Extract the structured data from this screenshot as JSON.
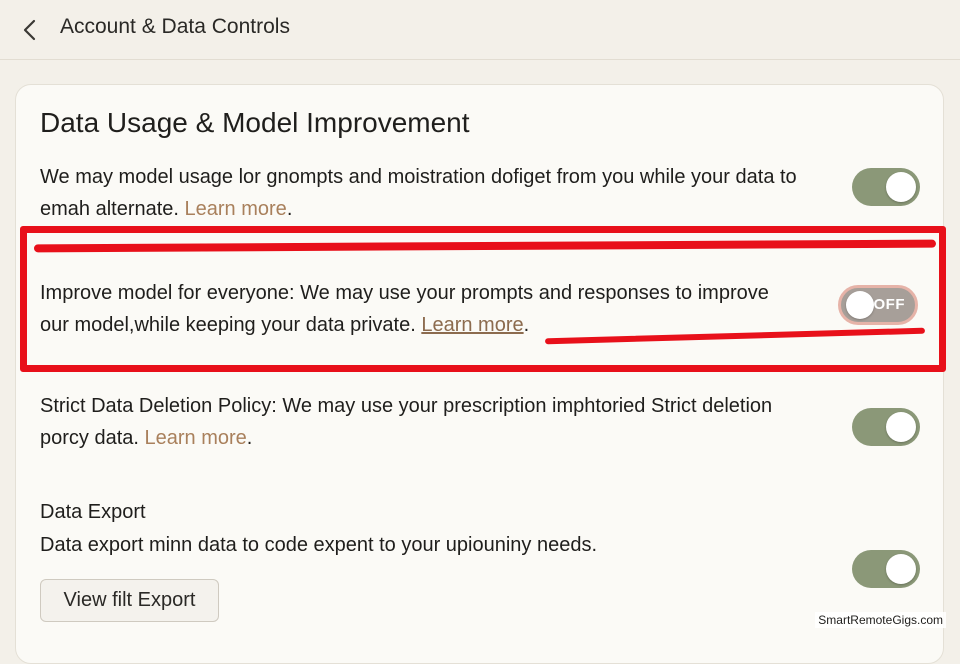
{
  "header": {
    "title": "Account & Data Controls",
    "back_icon": "chevron-left-icon"
  },
  "card": {
    "title": "Data Usage & Model Improvement"
  },
  "settings": [
    {
      "text": "We may model usage lor  gnompts and moistration dofiget from you while your data to emah alternate. ",
      "link": "Learn more",
      "after_link": ".",
      "enabled": true
    },
    {
      "text": "Improve model for everyone: We may use your prompts and responses to improve our model,while keeping your data private. ",
      "link": "Learn more",
      "after_link": ".",
      "enabled": false,
      "toggle_label": "OFF"
    },
    {
      "text": "Strict Data Deletion Policy: We may use your prescription imphtoried Strict deletion porcy data. ",
      "link": "Learn more",
      "after_link": ".",
      "enabled": true
    }
  ],
  "export": {
    "heading": "Data Export",
    "description": "Data export minn data to code expent to your upiouniny needs.",
    "button_label": "View filt Export",
    "enabled": true
  },
  "annotation": {
    "color": "#e8101a"
  },
  "toggle_colors": {
    "on": "#8b9878",
    "off": "#a79f99"
  },
  "watermark": "SmartRemoteGigs.com"
}
